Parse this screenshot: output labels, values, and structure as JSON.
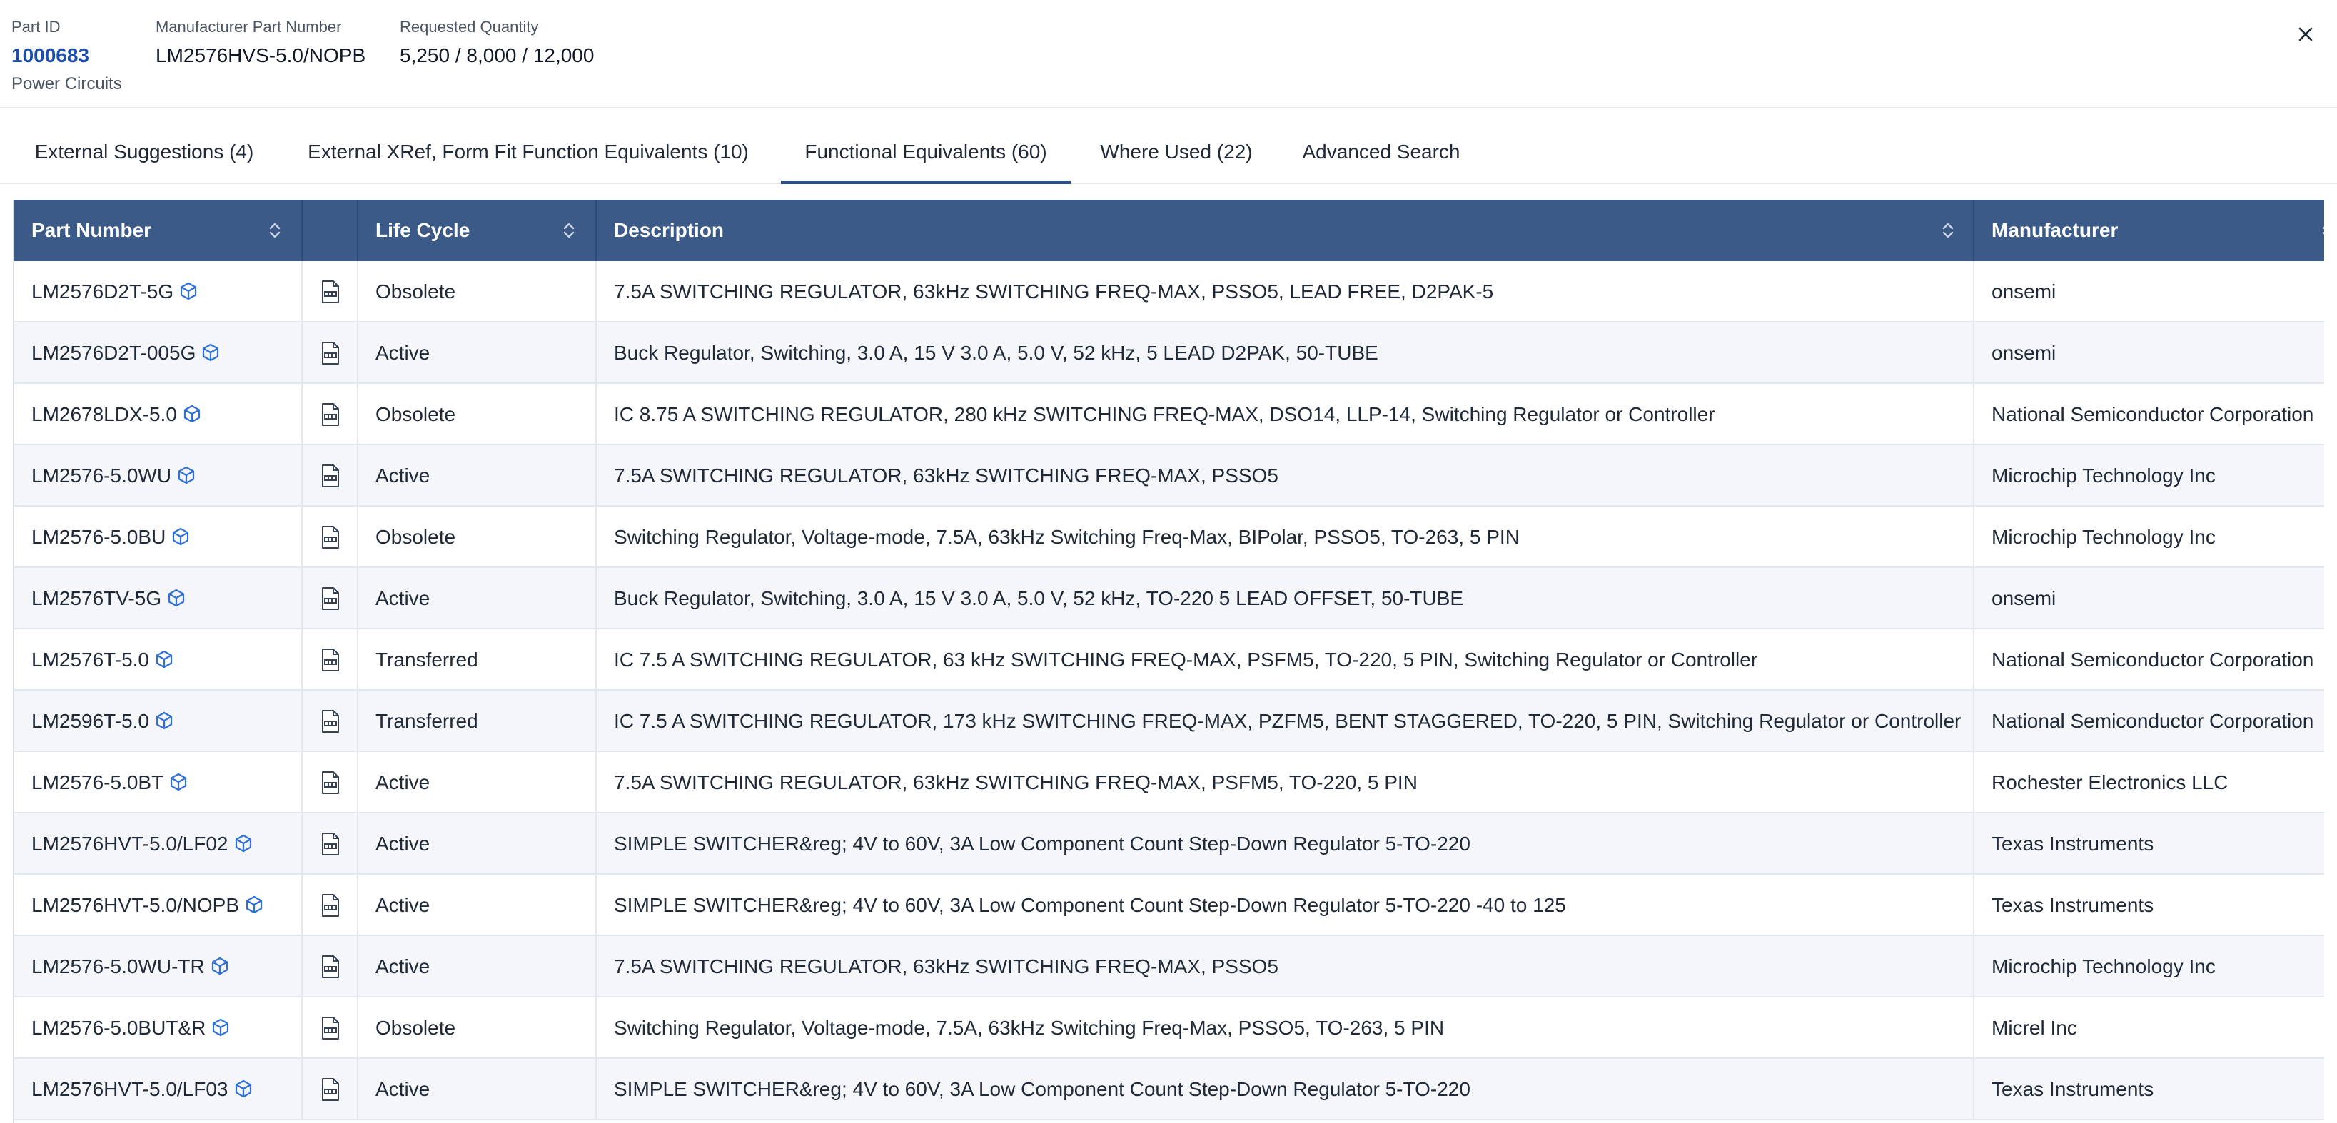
{
  "header": {
    "part_id_label": "Part ID",
    "part_id_value": "1000683",
    "part_id_sub": "Power Circuits",
    "mpn_label": "Manufacturer Part Number",
    "mpn_value": "LM2576HVS-5.0/NOPB",
    "qty_label": "Requested Quantity",
    "qty_value": "5,250 / 8,000 / 12,000",
    "close_icon": "close-icon"
  },
  "tabs": [
    {
      "label": "External Suggestions (4)",
      "active": false
    },
    {
      "label": "External XRef, Form Fit Function Equivalents (10)",
      "active": false
    },
    {
      "label": "Functional Equivalents (60)",
      "active": true
    },
    {
      "label": "Where Used (22)",
      "active": false
    },
    {
      "label": "Advanced Search",
      "active": false
    }
  ],
  "table": {
    "columns": [
      {
        "label": "Part Number",
        "sortable": true
      },
      {
        "label": "",
        "sortable": false
      },
      {
        "label": "Life Cycle",
        "sortable": true
      },
      {
        "label": "Description",
        "sortable": true
      },
      {
        "label": "Manufacturer",
        "sortable": true
      }
    ],
    "rows": [
      {
        "part": "LM2576D2T-5G",
        "life_cycle": "Obsolete",
        "description": "7.5A SWITCHING REGULATOR, 63kHz SWITCHING FREQ-MAX, PSSO5, LEAD FREE, D2PAK-5",
        "manufacturer": "onsemi"
      },
      {
        "part": "LM2576D2T-005G",
        "life_cycle": "Active",
        "description": "Buck Regulator, Switching, 3.0 A, 15 V 3.0 A, 5.0 V, 52 kHz, 5 LEAD D2PAK, 50-TUBE",
        "manufacturer": "onsemi"
      },
      {
        "part": "LM2678LDX-5.0",
        "life_cycle": "Obsolete",
        "description": "IC 8.75 A SWITCHING REGULATOR, 280 kHz SWITCHING FREQ-MAX, DSO14, LLP-14, Switching Regulator or Controller",
        "manufacturer": "National Semiconductor Corporation"
      },
      {
        "part": "LM2576-5.0WU",
        "life_cycle": "Active",
        "description": "7.5A SWITCHING REGULATOR, 63kHz SWITCHING FREQ-MAX, PSSO5",
        "manufacturer": "Microchip Technology Inc"
      },
      {
        "part": "LM2576-5.0BU",
        "life_cycle": "Obsolete",
        "description": "Switching Regulator, Voltage-mode, 7.5A, 63kHz Switching Freq-Max, BIPolar, PSSO5, TO-263, 5 PIN",
        "manufacturer": "Microchip Technology Inc"
      },
      {
        "part": "LM2576TV-5G",
        "life_cycle": "Active",
        "description": "Buck Regulator, Switching, 3.0 A, 15 V 3.0 A, 5.0 V, 52 kHz, TO-220 5 LEAD OFFSET, 50-TUBE",
        "manufacturer": "onsemi"
      },
      {
        "part": "LM2576T-5.0",
        "life_cycle": "Transferred",
        "description": "IC 7.5 A SWITCHING REGULATOR, 63 kHz SWITCHING FREQ-MAX, PSFM5, TO-220, 5 PIN, Switching Regulator or Controller",
        "manufacturer": "National Semiconductor Corporation"
      },
      {
        "part": "LM2596T-5.0",
        "life_cycle": "Transferred",
        "description": "IC 7.5 A SWITCHING REGULATOR, 173 kHz SWITCHING FREQ-MAX, PZFM5, BENT STAGGERED, TO-220, 5 PIN, Switching Regulator or Controller",
        "manufacturer": "National Semiconductor Corporation"
      },
      {
        "part": "LM2576-5.0BT",
        "life_cycle": "Active",
        "description": "7.5A SWITCHING REGULATOR, 63kHz SWITCHING FREQ-MAX, PSFM5, TO-220, 5 PIN",
        "manufacturer": "Rochester Electronics LLC"
      },
      {
        "part": "LM2576HVT-5.0/LF02",
        "life_cycle": "Active",
        "description": "SIMPLE SWITCHER&reg; 4V to 60V, 3A Low Component Count Step-Down Regulator 5-TO-220",
        "manufacturer": "Texas Instruments"
      },
      {
        "part": "LM2576HVT-5.0/NOPB",
        "life_cycle": "Active",
        "description": "SIMPLE SWITCHER&reg; 4V to 60V, 3A Low Component Count Step-Down Regulator 5-TO-220 -40 to 125",
        "manufacturer": "Texas Instruments"
      },
      {
        "part": "LM2576-5.0WU-TR",
        "life_cycle": "Active",
        "description": "7.5A SWITCHING REGULATOR, 63kHz SWITCHING FREQ-MAX, PSSO5",
        "manufacturer": "Microchip Technology Inc"
      },
      {
        "part": "LM2576-5.0BUT&R",
        "life_cycle": "Obsolete",
        "description": "Switching Regulator, Voltage-mode, 7.5A, 63kHz Switching Freq-Max, PSSO5, TO-263, 5 PIN",
        "manufacturer": "Micrel Inc"
      },
      {
        "part": "LM2576HVT-5.0/LF03",
        "life_cycle": "Active",
        "description": "SIMPLE SWITCHER&reg; 4V to 60V, 3A Low Component Count Step-Down Regulator 5-TO-220",
        "manufacturer": "Texas Instruments"
      }
    ],
    "icons": {
      "part": "cube-icon",
      "datasheet": "pdf-icon",
      "sort": "sort-icon"
    }
  },
  "colors": {
    "header_bg": "#3b5a88",
    "link": "#1d4fae",
    "tab_active": "#2b4f86",
    "row_alt": "#f4f6fa",
    "cube_icon": "#2f6fd6"
  }
}
